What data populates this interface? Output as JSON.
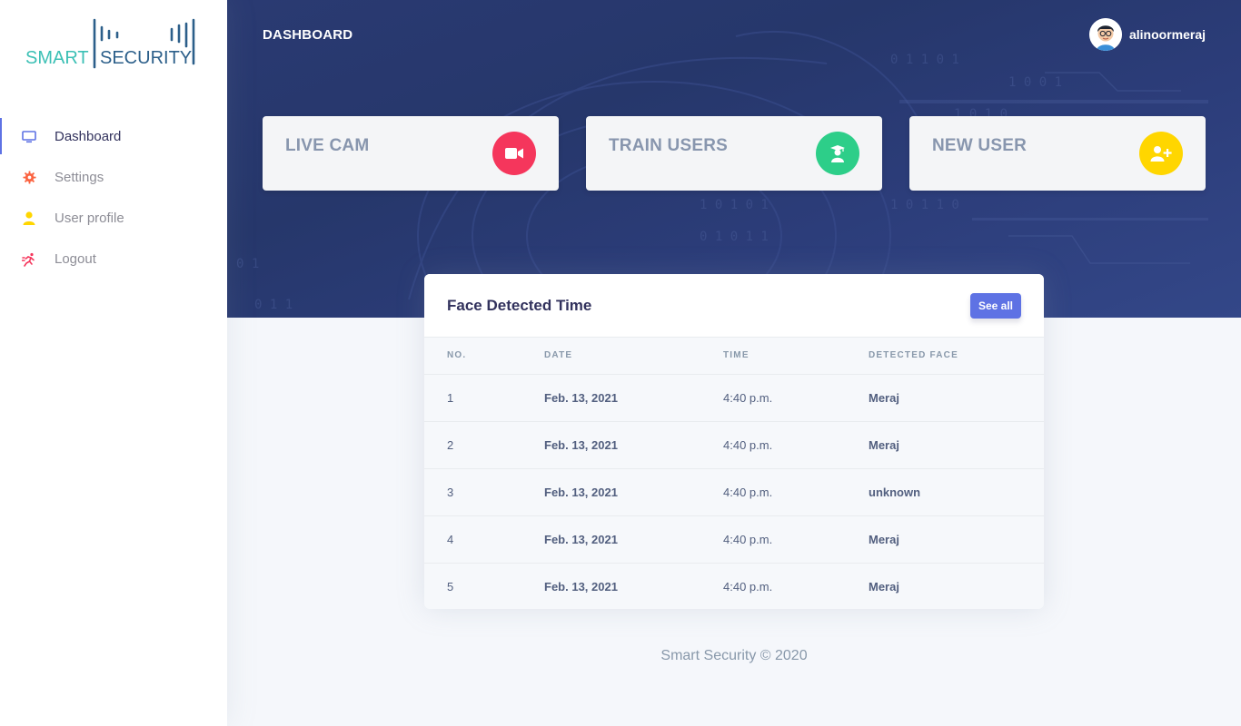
{
  "brand": {
    "word1": "SMART",
    "word2": "SECURITY"
  },
  "sidebar": {
    "items": [
      {
        "label": "Dashboard",
        "icon": "monitor-icon",
        "active": true
      },
      {
        "label": "Settings",
        "icon": "gear-icon"
      },
      {
        "label": "User profile",
        "icon": "user-icon"
      },
      {
        "label": "Logout",
        "icon": "running-icon"
      }
    ]
  },
  "header": {
    "title": "DASHBOARD",
    "username": "alinoormeraj"
  },
  "cards": [
    {
      "label": "LIVE CAM",
      "icon": "video-camera-icon",
      "color": "#f5365c"
    },
    {
      "label": "TRAIN USERS",
      "icon": "graduate-icon",
      "color": "#2dce89"
    },
    {
      "label": "NEW USER",
      "icon": "user-plus-icon",
      "color": "#ffd600"
    }
  ],
  "table": {
    "title": "Face Detected Time",
    "see_all": "See all",
    "columns": [
      "NO.",
      "DATE",
      "TIME",
      "DETECTED FACE"
    ],
    "rows": [
      {
        "no": "1",
        "date": "Feb. 13, 2021",
        "time": "4:40 p.m.",
        "face": "Meraj"
      },
      {
        "no": "2",
        "date": "Feb. 13, 2021",
        "time": "4:40 p.m.",
        "face": "Meraj"
      },
      {
        "no": "3",
        "date": "Feb. 13, 2021",
        "time": "4:40 p.m.",
        "face": "unknown"
      },
      {
        "no": "4",
        "date": "Feb. 13, 2021",
        "time": "4:40 p.m.",
        "face": "Meraj"
      },
      {
        "no": "5",
        "date": "Feb. 13, 2021",
        "time": "4:40 p.m.",
        "face": "Meraj"
      }
    ]
  },
  "footer": {
    "text": "Smart Security © 2020"
  },
  "colors": {
    "accent": "#5e72e4",
    "header_bg": "#2a3a72"
  }
}
